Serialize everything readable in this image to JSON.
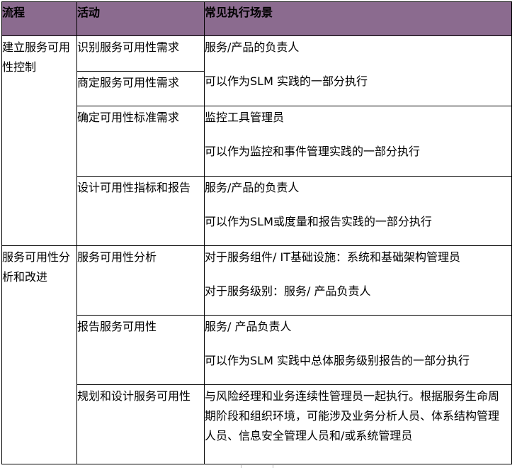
{
  "header": {
    "col1": "流程",
    "col2": "活动",
    "col3": "常见执行场景"
  },
  "rows": [
    {
      "process": "建立服务可用性控制",
      "activity": "识别服务可用性需求",
      "scene": [
        "服务/产品的负责人"
      ]
    },
    {
      "activity": "商定服务可用性需求",
      "scene": [
        "可以作为SLM 实践的一部分执行"
      ]
    },
    {
      "activity": "确定可用性标准需求",
      "scene": [
        "监控工具管理员",
        "可以作为监控和事件管理实践的一部分执行"
      ]
    },
    {
      "activity": "设计可用性指标和报告",
      "scene": [
        "服务/产品的负责人",
        "可以作为SLM或度量和报告实践的一部分执行"
      ]
    },
    {
      "process": "服务可用性分析和改进",
      "activity": "服务可用性分析",
      "scene": [
        "对于服务组件/ IT基础设施：系统和基础架构管理员",
        "对于服务级别：服务/ 产品负责人"
      ]
    },
    {
      "activity": "报告服务可用性",
      "scene": [
        "服务/ 产品负责人",
        "可以作为SLM 实践中总体服务级别报告的一部分执行"
      ]
    },
    {
      "activity": "规划和设计服务可用性",
      "scene": [
        "与风险经理和业务连续性管理员一起执行。根据服务生命周期阶段和组织环境，可能涉及业务分析人员、体系结构管理人员、信息安全管理人员和/或系统管理员"
      ]
    }
  ]
}
